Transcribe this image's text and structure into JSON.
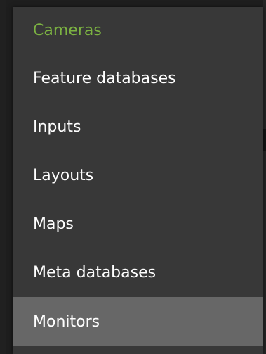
{
  "menu": {
    "items": [
      {
        "label": "Cameras",
        "state": "current"
      },
      {
        "label": "Feature databases",
        "state": "normal"
      },
      {
        "label": "Inputs",
        "state": "normal"
      },
      {
        "label": "Layouts",
        "state": "normal"
      },
      {
        "label": "Maps",
        "state": "normal"
      },
      {
        "label": "Meta databases",
        "state": "normal"
      },
      {
        "label": "Monitors",
        "state": "hover"
      }
    ]
  },
  "colors": {
    "menu_background": "#383838",
    "current_item_text": "#7cb342",
    "item_text": "#ffffff",
    "hover_background": "#676767",
    "page_background": "#1e1e1e"
  }
}
